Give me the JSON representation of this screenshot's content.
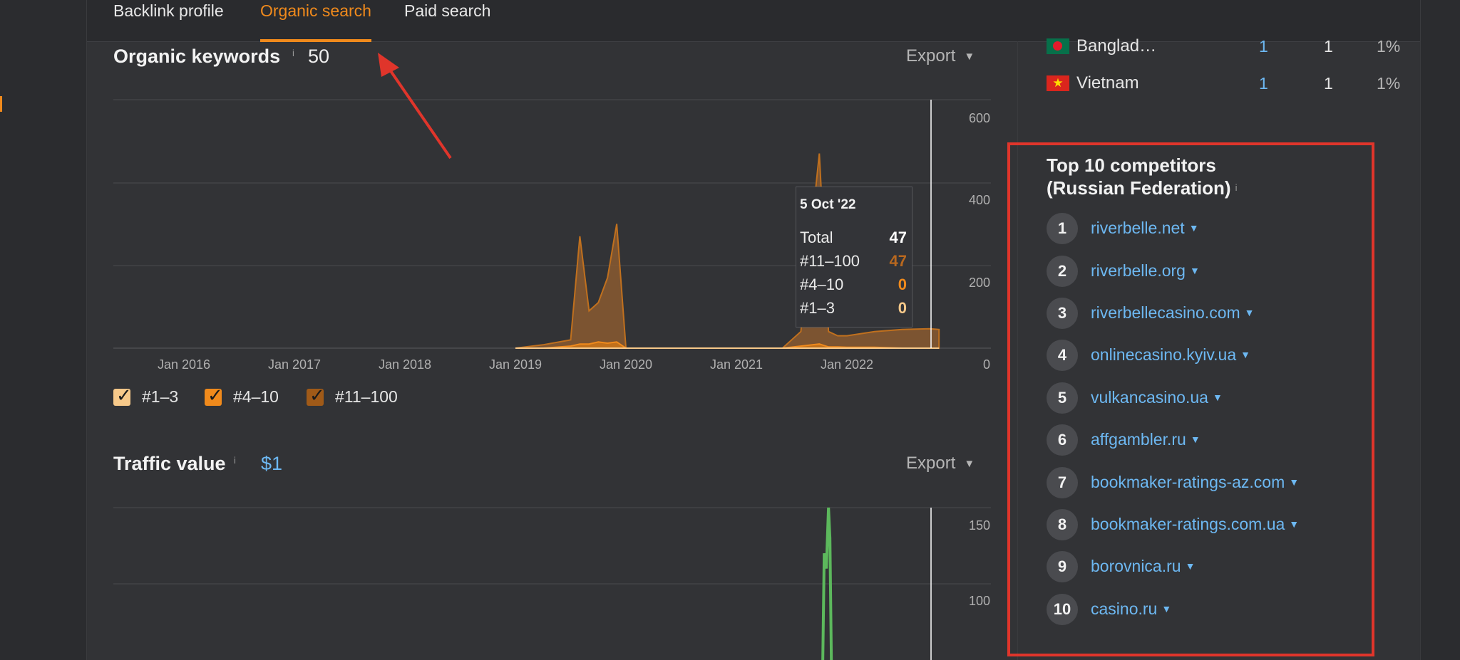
{
  "tabs": [
    {
      "label": "Backlink profile",
      "active": false
    },
    {
      "label": "Organic search",
      "active": true
    },
    {
      "label": "Paid search",
      "active": false
    }
  ],
  "organic": {
    "title": "Organic keywords",
    "info": "i",
    "count": "50",
    "export": "Export",
    "legend": [
      {
        "label": "#1–3",
        "color": "#f7c98a"
      },
      {
        "label": "#4–10",
        "color": "#f08a1c"
      },
      {
        "label": "#11–100",
        "color": "#a05a18"
      }
    ],
    "tooltip": {
      "date": "5 Oct '22",
      "rows": [
        {
          "label": "Total",
          "value": "47"
        },
        {
          "label": "#11–100",
          "value": "47"
        },
        {
          "label": "#4–10",
          "value": "0"
        },
        {
          "label": "#1–3",
          "value": "0"
        }
      ]
    }
  },
  "traffic": {
    "title": "Traffic value",
    "info": "i",
    "count": "$1",
    "export": "Export"
  },
  "countries": [
    {
      "name": "Banglad…",
      "flag": "bangladesh-flag",
      "v1": "1",
      "v2": "1",
      "pct": "1%"
    },
    {
      "name": "Vietnam",
      "flag": "vietnam-flag",
      "v1": "1",
      "v2": "1",
      "pct": "1%"
    }
  ],
  "competitors": {
    "title_line1": "Top 10 competitors",
    "title_line2": "(Russian Federation)",
    "info": "i",
    "items": [
      {
        "rank": "1",
        "domain": "riverbelle.net"
      },
      {
        "rank": "2",
        "domain": "riverbelle.org"
      },
      {
        "rank": "3",
        "domain": "riverbellecasino.com"
      },
      {
        "rank": "4",
        "domain": "onlinecasino.kyiv.ua"
      },
      {
        "rank": "5",
        "domain": "vulkancasino.ua"
      },
      {
        "rank": "6",
        "domain": "affgambler.ru"
      },
      {
        "rank": "7",
        "domain": "bookmaker-ratings-az.com"
      },
      {
        "rank": "8",
        "domain": "bookmaker-ratings.com.ua"
      },
      {
        "rank": "9",
        "domain": "borovnica.ru"
      },
      {
        "rank": "10",
        "domain": "casino.ru"
      }
    ]
  },
  "chart_data": [
    {
      "type": "area",
      "title": "Organic keywords",
      "x_ticks": [
        "Jan 2016",
        "Jan 2017",
        "Jan 2018",
        "Jan 2019",
        "Jan 2020",
        "Jan 2021",
        "Jan 2022"
      ],
      "y_ticks": [
        "600",
        "400",
        "200",
        "0"
      ],
      "ylim": [
        0,
        600
      ],
      "x": [
        "2019-01",
        "2019-04",
        "2019-07",
        "2019-08",
        "2019-09",
        "2019-10",
        "2019-11",
        "2019-12",
        "2020-01",
        "2020-02",
        "2020-05",
        "2021-06",
        "2021-08",
        "2021-10",
        "2021-11",
        "2021-12",
        "2022-01",
        "2022-04",
        "2022-07",
        "2022-10",
        "2022-11"
      ],
      "series": [
        {
          "name": "#11–100",
          "values": [
            0,
            8,
            20,
            270,
            90,
            110,
            170,
            300,
            0,
            0,
            0,
            0,
            40,
            470,
            40,
            30,
            30,
            40,
            45,
            47,
            45
          ]
        },
        {
          "name": "#4–10",
          "values": [
            0,
            0,
            5,
            10,
            10,
            15,
            12,
            15,
            0,
            0,
            0,
            0,
            5,
            10,
            3,
            3,
            2,
            2,
            0,
            0,
            0
          ]
        },
        {
          "name": "#1–3",
          "values": [
            0,
            0,
            0,
            0,
            0,
            0,
            0,
            0,
            0,
            0,
            0,
            0,
            0,
            0,
            0,
            0,
            0,
            0,
            0,
            0,
            0
          ]
        }
      ]
    },
    {
      "type": "line",
      "title": "Traffic value",
      "y_ticks": [
        "150",
        "100"
      ],
      "ylim": [
        50,
        160
      ],
      "x": [
        "2021-10",
        "2021-11",
        "2021-12"
      ],
      "series": [
        {
          "name": "Traffic value",
          "color": "#5cb85c",
          "values": [
            60,
            150,
            60
          ]
        }
      ]
    }
  ]
}
